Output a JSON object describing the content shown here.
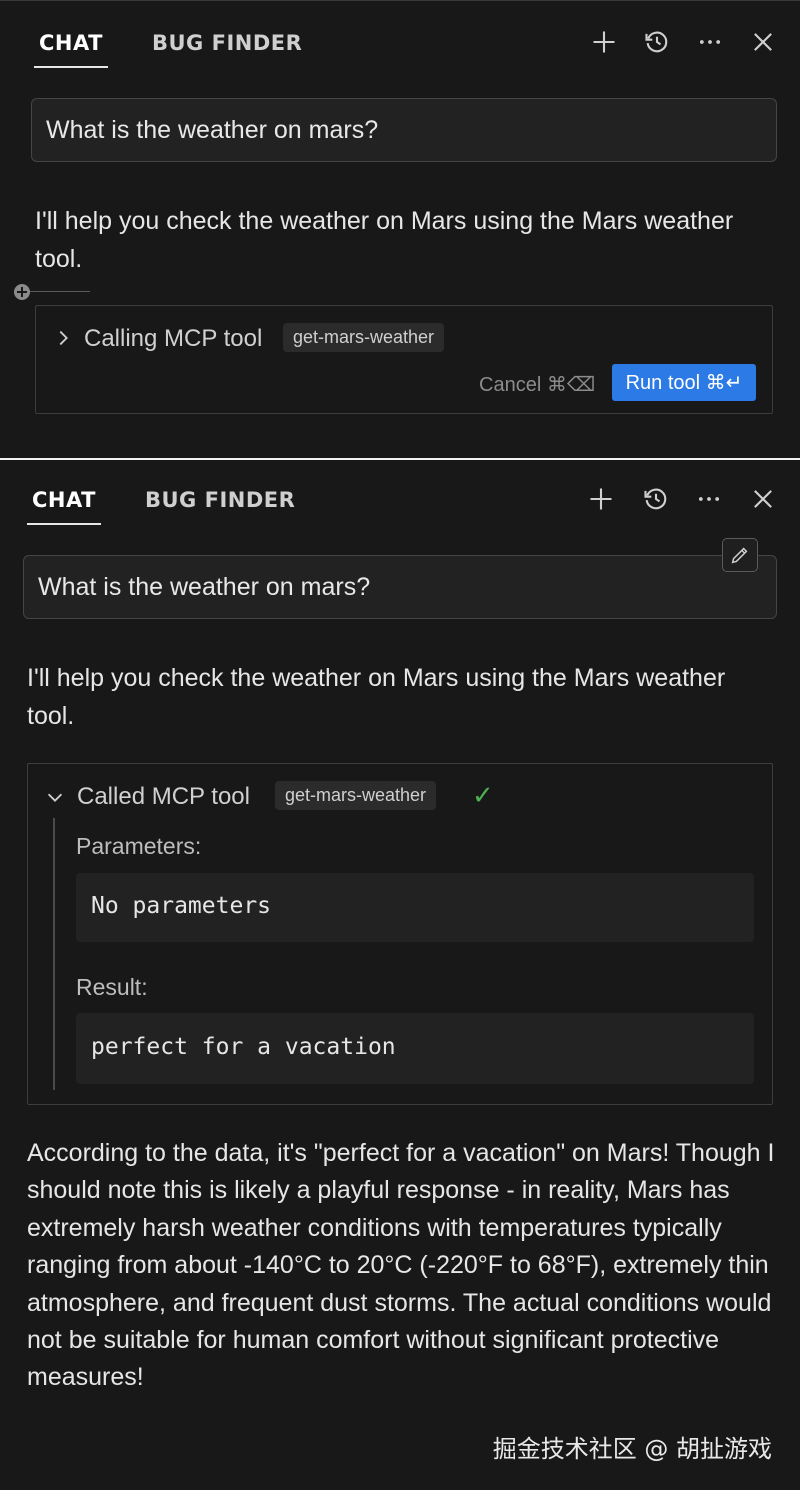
{
  "top": {
    "tabs": [
      "CHAT",
      "BUG FINDER"
    ],
    "query": "What is the weather on mars?",
    "assistant_intro": "I'll help you check the weather on Mars using the Mars weather tool.",
    "tool": {
      "status_label": "Calling MCP tool",
      "tool_name": "get-mars-weather",
      "cancel_label": "Cancel ⌘⌫",
      "run_label": "Run tool ⌘↵"
    }
  },
  "bottom": {
    "tabs": [
      "CHAT",
      "BUG FINDER"
    ],
    "query": "What is the weather on mars?",
    "assistant_intro": "I'll help you check the weather on Mars using the Mars weather tool.",
    "tool": {
      "status_label": "Called MCP tool",
      "tool_name": "get-mars-weather",
      "check": "✓",
      "parameters_label": "Parameters:",
      "parameters_value": "No parameters",
      "result_label": "Result:",
      "result_value": "perfect for a vacation"
    },
    "assistant_answer": "According to the data, it's \"perfect for a vacation\" on Mars! Though I should note this is likely a playful response - in reality, Mars has extremely harsh weather conditions with temperatures typically ranging from about -140°C to 20°C (-220°F to 68°F), extremely thin atmosphere, and frequent dust storms. The actual conditions would not be suitable for human comfort without significant protective measures!"
  },
  "watermark": "掘金技术社区 @ 胡扯游戏",
  "colors": {
    "background": "#181818",
    "accent": "#2b7ae5",
    "success": "#4caf50"
  },
  "icons": [
    "plus-icon",
    "history-icon",
    "more-icon",
    "close-icon",
    "chevron-right-icon",
    "chevron-down-icon",
    "edit-icon",
    "check-icon"
  ]
}
